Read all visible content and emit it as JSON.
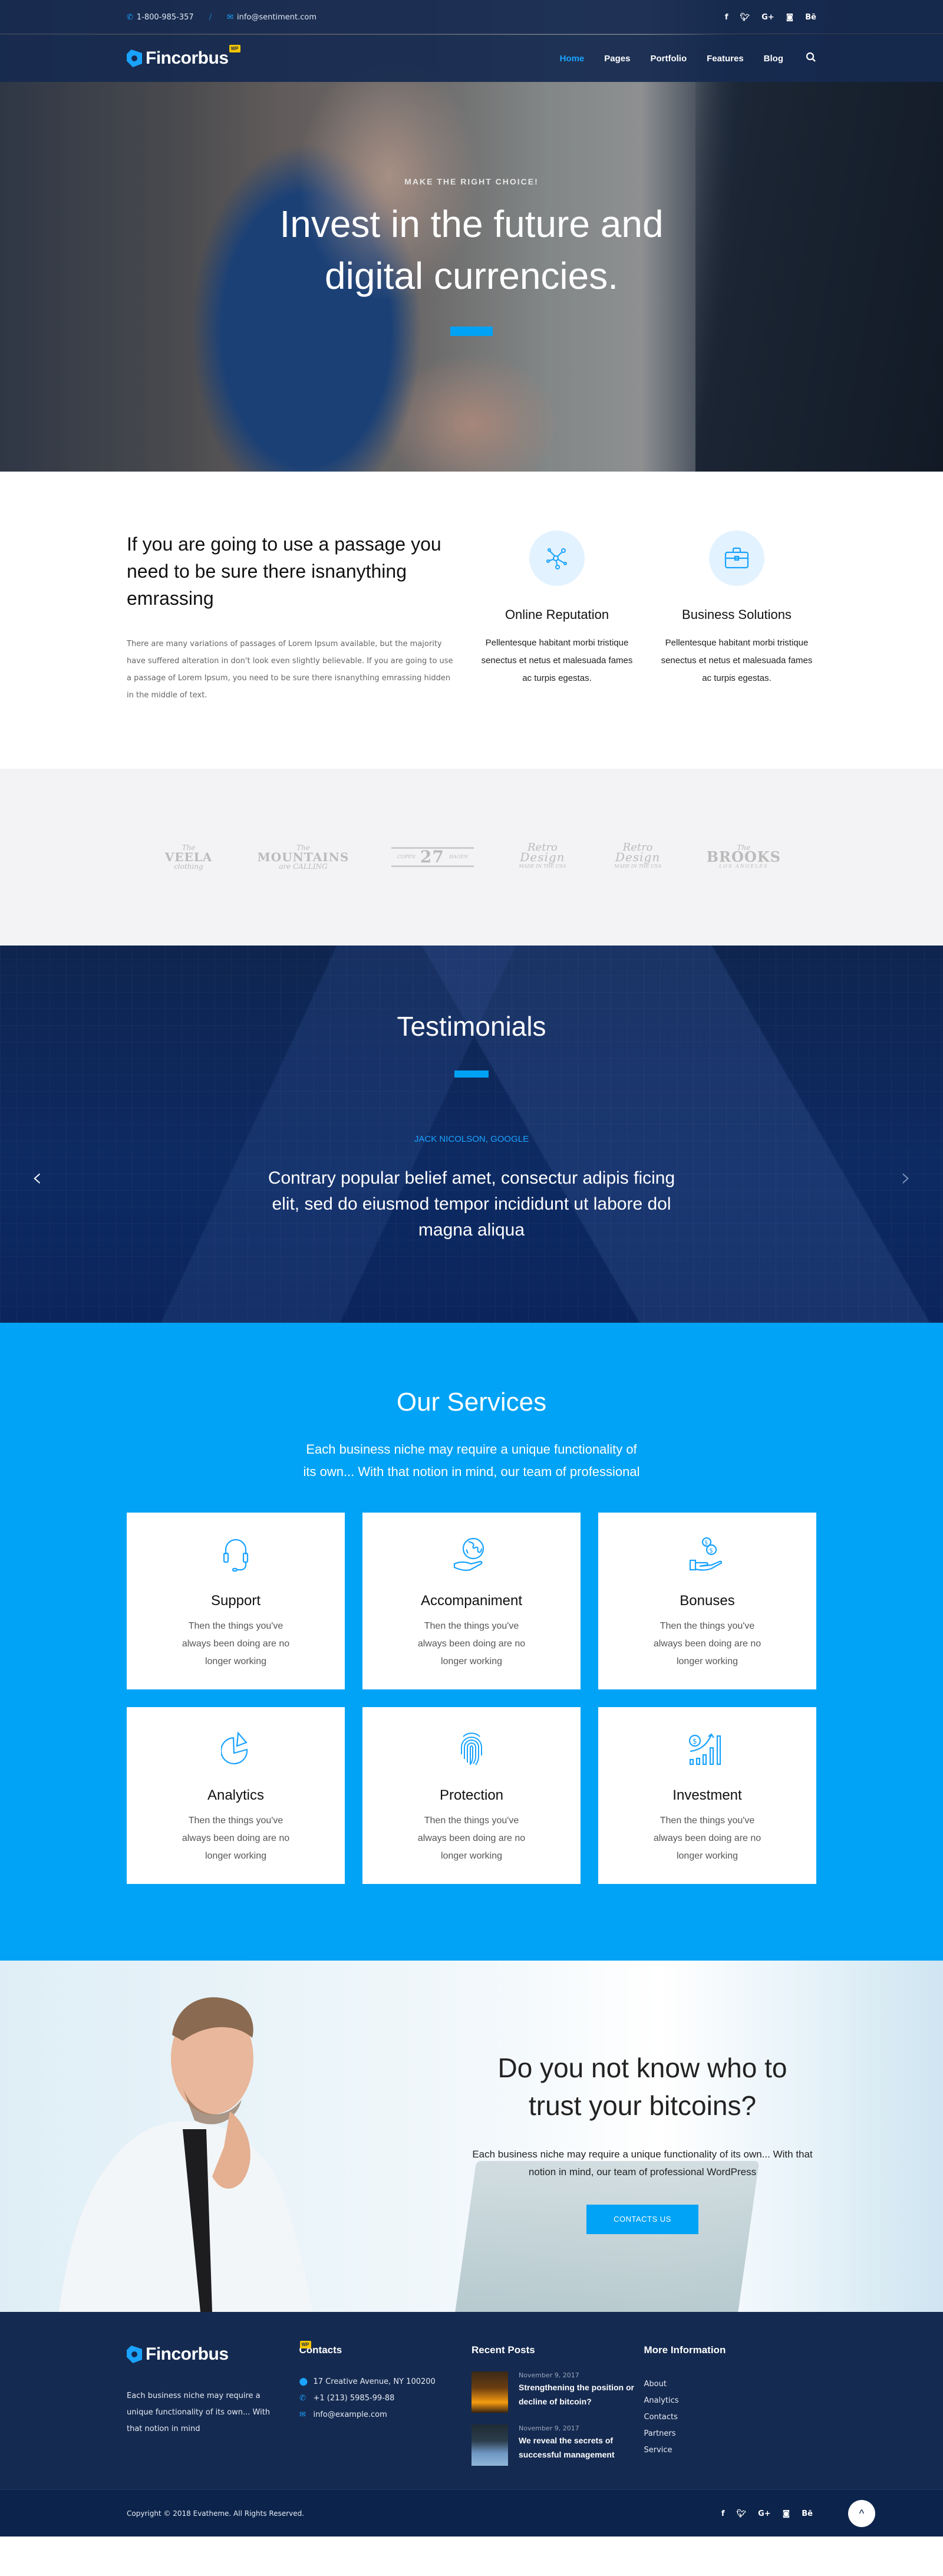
{
  "topbar": {
    "phone": "1-800-985-357",
    "email": "info@sentiment.com",
    "social": [
      "f",
      "t",
      "G+",
      "ig",
      "Bē"
    ]
  },
  "brand": {
    "name": "Fincorbus",
    "badge": "WP",
    "accent": "#00a3f5",
    "navy": "#152a50"
  },
  "nav": {
    "items": [
      "Home",
      "Pages",
      "Portfolio",
      "Features",
      "Blog"
    ],
    "active": "Home"
  },
  "hero": {
    "eyebrow": "MAKE THE RIGHT CHOICE!",
    "title_line1": "Invest in the future and",
    "title_line2": "digital currencies."
  },
  "intro": {
    "title": "If you are going to use a passage you need to be sure there isnanything emrassing",
    "text": "There are many variations of passages of Lorem Ipsum available, but the majority have suffered alteration in don't look even slightly believable. If you are going to use a passage of Lorem Ipsum, you need to be sure there isnanything emrassing hidden in the middle of text.",
    "features": [
      {
        "icon": "network-icon",
        "title": "Online Reputation",
        "text": "Pellentesque habitant morbi tristique senectus et netus et malesuada fames ac turpis egestas."
      },
      {
        "icon": "briefcase-icon",
        "title": "Business Solutions",
        "text": "Pellentesque habitant morbi tristique senectus et netus et malesuada fames ac turpis egestas."
      }
    ]
  },
  "partners": [
    {
      "top": "The",
      "main": "VEELA",
      "sub": "clothing"
    },
    {
      "top": "The",
      "main": "MOUNTAINS",
      "sub": "are CALLING"
    },
    {
      "top": "COPEN",
      "main": "27",
      "sub": "HAGEN"
    },
    {
      "top": "Retro",
      "main": "Design",
      "sub": "MADE IN THE USA"
    },
    {
      "top": "Retro",
      "main": "Design",
      "sub": "MADE IN THE USA"
    },
    {
      "top": "The",
      "main": "BROOKS",
      "sub": "LOS ANGELES"
    }
  ],
  "testimonials": {
    "title": "Testimonials",
    "author": "JACK NICOLSON, GOOGLE",
    "quote": "Contrary popular belief amet, consectur adipis ficing elit, sed do eiusmod tempor incididunt ut labore dol magna aliqua",
    "prev": "‹",
    "next": "›"
  },
  "services": {
    "title": "Our Services",
    "subtitle": "Each business niche may require a unique functionality of its own... With that notion in mind, our team of professional",
    "cards": [
      {
        "icon": "headset-icon",
        "title": "Support",
        "text": "Then the things you've always been doing are no longer working"
      },
      {
        "icon": "globe-hand-icon",
        "title": "Accompaniment",
        "text": "Then the things you've always been doing are no longer working"
      },
      {
        "icon": "coins-hand-icon",
        "title": "Bonuses",
        "text": "Then the things you've always been doing are no longer working"
      },
      {
        "icon": "pie-chart-icon",
        "title": "Analytics",
        "text": "Then the things you've always been doing are no longer working"
      },
      {
        "icon": "fingerprint-icon",
        "title": "Protection",
        "text": "Then the things you've always been doing are no longer working"
      },
      {
        "icon": "growth-chart-icon",
        "title": "Investment",
        "text": "Then the things you've always been doing are no longer working"
      }
    ]
  },
  "cta": {
    "title_line1": "Do you not know who to",
    "title_line2": "trust your bitcoins?",
    "text": "Each business niche may require a unique functionality of its own... With that notion in mind, our team of professional WordPress",
    "button": "CONTACTS US"
  },
  "footer": {
    "about": "Each business niche may require a unique functionality of its own... With that notion in mind",
    "contacts_title": "Contacts",
    "address": "17 Creative Avenue, NY 100200",
    "phone": "+1 (213) 5985-99-88",
    "email": "info@example.com",
    "posts_title": "Recent Posts",
    "posts": [
      {
        "date": "November 9, 2017",
        "title": "Strengthening the position or decline of bitcoin?"
      },
      {
        "date": "November 9, 2017",
        "title": "We reveal the secrets of successful management"
      }
    ],
    "more_title": "More Information",
    "links": [
      "About",
      "Analytics",
      "Contacts",
      "Partners",
      "Service"
    ],
    "copyright": "Copyright © 2018 Evatheme. All Rights Reserved.",
    "to_top": "^"
  }
}
